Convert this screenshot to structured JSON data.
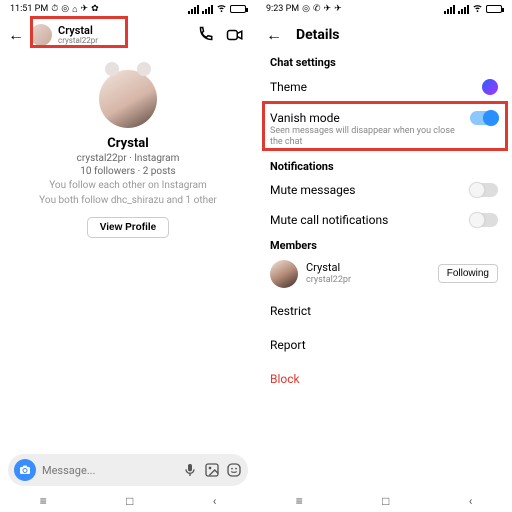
{
  "left": {
    "status_time": "11:51 PM",
    "display_name": "Crystal",
    "username": "crystal22pr",
    "name_line": "Crystal",
    "sub_line": "crystal22pr · Instagram",
    "stats_line": "10 followers · 2 posts",
    "desc_line1": "You follow each other on Instagram",
    "desc_line2": "You both follow dhc_shirazu and 1 other",
    "view_profile": "View Profile",
    "composer_placeholder": "Message..."
  },
  "right": {
    "status_time": "9:23 PM",
    "title": "Details",
    "chat_settings": "Chat settings",
    "theme": "Theme",
    "vanish_title": "Vanish mode",
    "vanish_sub": "Seen messages will disappear when you close the chat",
    "notifications": "Notifications",
    "mute_messages": "Mute messages",
    "mute_calls": "Mute call notifications",
    "members": "Members",
    "member_display": "Crystal",
    "member_user": "crystal22pr",
    "following": "Following",
    "restrict": "Restrict",
    "report": "Report",
    "block": "Block"
  }
}
